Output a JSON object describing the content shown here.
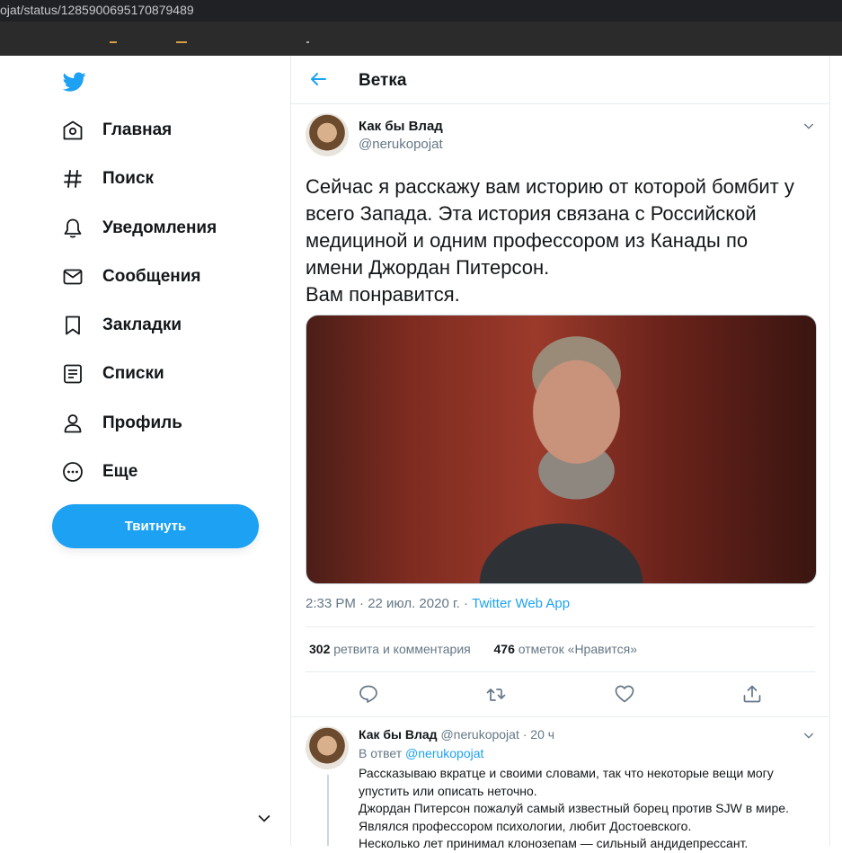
{
  "browser": {
    "url": "ojat/status/1285900695170879489"
  },
  "nav": {
    "items": [
      {
        "label": "Главная",
        "icon": "home-icon"
      },
      {
        "label": "Поиск",
        "icon": "hashtag-icon"
      },
      {
        "label": "Уведомления",
        "icon": "bell-icon"
      },
      {
        "label": "Сообщения",
        "icon": "envelope-icon"
      },
      {
        "label": "Закладки",
        "icon": "bookmark-icon"
      },
      {
        "label": "Списки",
        "icon": "list-icon"
      },
      {
        "label": "Профиль",
        "icon": "person-icon"
      },
      {
        "label": "Еще",
        "icon": "more-circle-icon"
      }
    ],
    "tweet_button": "Твитнуть"
  },
  "header": {
    "title": "Ветка"
  },
  "tweet": {
    "name": "Как бы Влад",
    "handle": "@nerukopojat",
    "lines": [
      "Сейчас я расскажу вам историю от которой бомбит у всего Запада. Эта история связана с Российской медициной и одним профессором из Канады по имени Джордан Питерсон.",
      "Вам понравится."
    ],
    "time": "2:33 PM · 22 июл. 2020 г. · ",
    "app": "Twitter Web App",
    "retweets_count": "302",
    "retweets_label": " ретвита и комментария",
    "likes_count": "476",
    "likes_label": " отметок «Нравится»"
  },
  "reply": {
    "name": "Как бы Влад",
    "handle_time": "@nerukopojat · 20 ч",
    "reply_to_prefix": "В ответ ",
    "reply_to_handle": "@nerukopojat",
    "paragraphs": [
      "Рассказываю вкратце и своими словами, так что некоторые вещи могу упустить или описать неточно.",
      "Джордан Питерсон пожалуй самый известный борец против SJW в мире. Являлся профессором психологии, любит Достоевского.",
      "Несколько лет принимал клонозепам — сильный андидепрессант."
    ]
  },
  "colors": {
    "accent": "#1da1f2",
    "text": "#14171a",
    "muted": "#657786",
    "border": "#e6ecf0"
  }
}
